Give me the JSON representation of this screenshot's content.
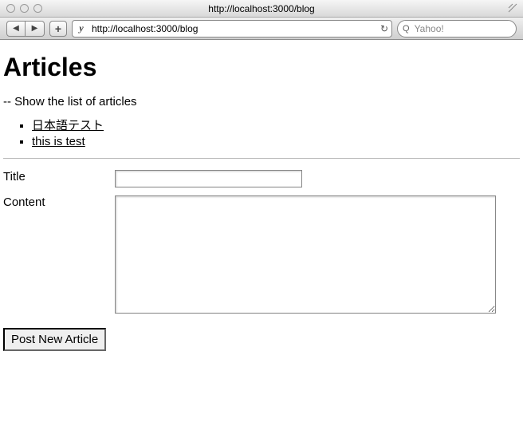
{
  "window": {
    "title": "http://localhost:3000/blog"
  },
  "toolbar": {
    "back": "◀",
    "forward": "▶",
    "plus": "+",
    "favicon": "y",
    "url": "http://localhost:3000/blog",
    "reload": "↻",
    "search_icon": "Q",
    "search_placeholder": "Yahoo!"
  },
  "page": {
    "heading": "Articles",
    "subtitle": "-- Show the list of articles",
    "articles": {
      "item0": "日本語テスト",
      "item1": "this is test"
    },
    "form": {
      "title_label": "Title",
      "title_value": "",
      "content_label": "Content",
      "content_value": "",
      "submit_label": "Post New Article"
    }
  }
}
